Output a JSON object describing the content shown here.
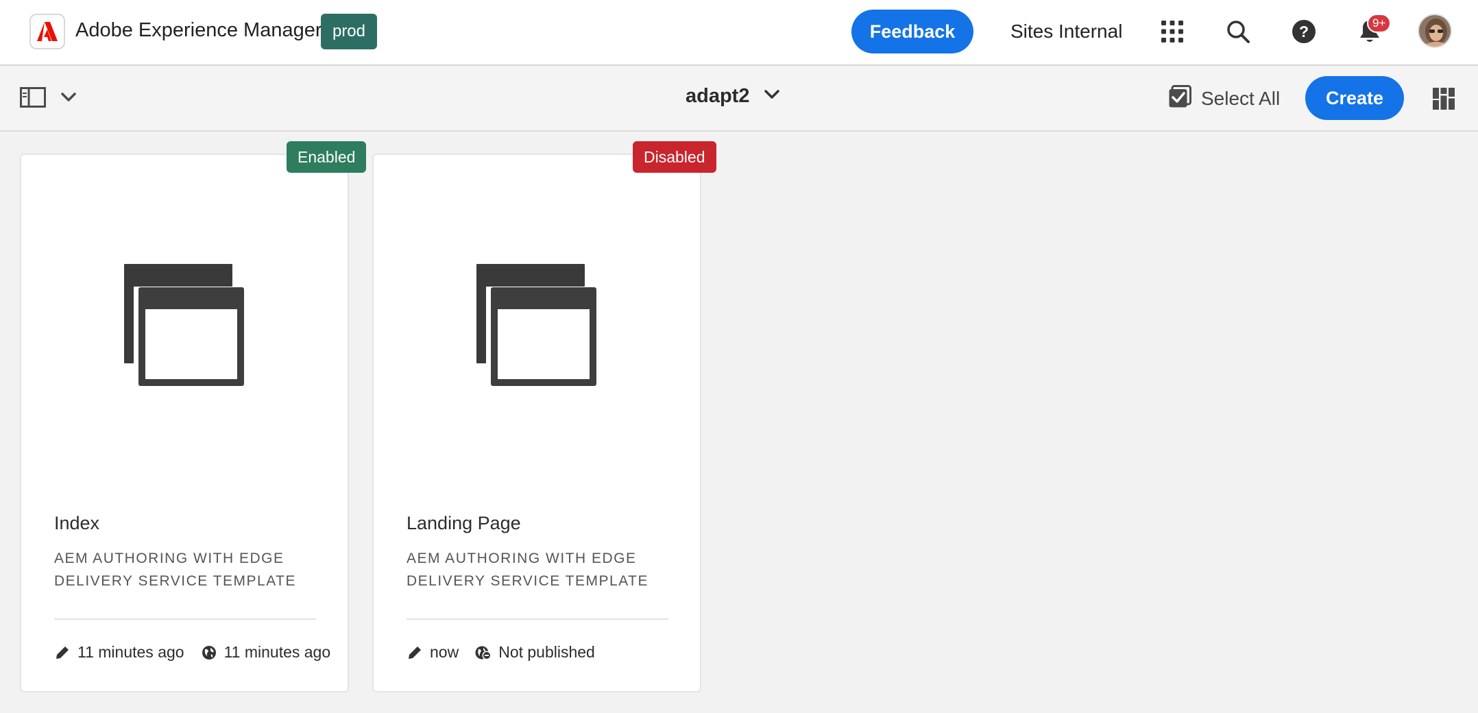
{
  "header": {
    "app_title": "Adobe Experience Manager",
    "environment": "prod",
    "feedback_label": "Feedback",
    "org_name": "Sites Internal",
    "notification_count": "9+",
    "icons": [
      "adobe-logo-icon",
      "app-switcher-icon",
      "search-icon",
      "help-icon",
      "bell-icon"
    ]
  },
  "actionbar": {
    "title": "adapt2",
    "select_all_label": "Select All",
    "create_label": "Create"
  },
  "cards": [
    {
      "title": "Index",
      "subtitle": "AEM AUTHORING WITH EDGE DELIVERY SERVICE TEMPLATE",
      "status": "Enabled",
      "status_color": "#2d7d5e",
      "modified": "11 minutes ago",
      "published": "11 minutes ago"
    },
    {
      "title": "Landing Page",
      "subtitle": "AEM AUTHORING WITH EDGE DELIVERY SERVICE TEMPLATE",
      "status": "Disabled",
      "status_color": "#c9252d",
      "modified": "now",
      "published": "Not published"
    }
  ],
  "colors": {
    "accent": "#1473e6",
    "env_badge": "#2d6e64",
    "notification": "#d7373f"
  }
}
